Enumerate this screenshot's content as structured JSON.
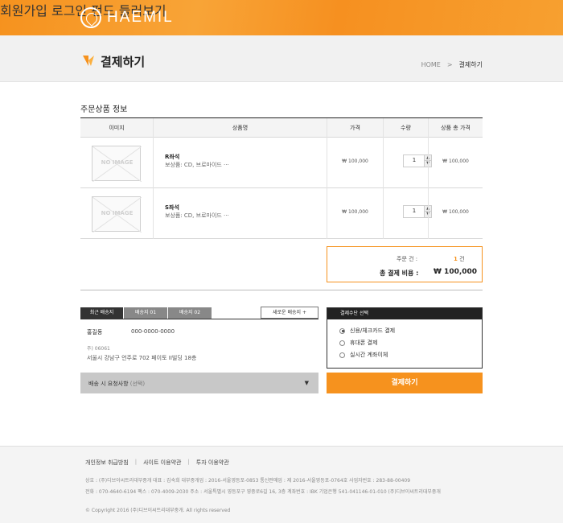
{
  "header": {
    "logo_text": "HAEMIL",
    "nav": [
      "회원가입",
      "로그인",
      "펀드 둘러보기"
    ]
  },
  "title_band": {
    "title": "결제하기",
    "breadcrumb": [
      "HOME",
      ">",
      "결제하기"
    ]
  },
  "order": {
    "section_title": "주문상품 정보",
    "columns": [
      "이미지",
      "상품명",
      "가격",
      "수량",
      "상품 총 가격"
    ],
    "rows": [
      {
        "image": "NO IMAGE",
        "name": "R좌석",
        "desc": "보상품: CD, 브로마이드 ···",
        "price": "₩ 100,000",
        "qty": "1",
        "total": "₩ 100,000"
      },
      {
        "image": "NO IMAGE",
        "name": "S좌석",
        "desc": "보상품: CD, 브로마이드 ···",
        "price": "₩ 100,000",
        "qty": "1",
        "total": "₩ 100,000"
      }
    ],
    "summary": {
      "count_label": "주문 건 :",
      "count_value": "1",
      "count_unit": "건",
      "total_label": "총 결제 비용 :",
      "total_value": "₩ 100,000"
    }
  },
  "delivery": {
    "tabs": [
      "최근 배송지",
      "배송지 01",
      "배송지 02"
    ],
    "new_button": "새로운 배송지 +",
    "name": "홍길동",
    "phone": "000-0000-0000",
    "zip": "주) 06061",
    "address": "서울시 강남구 언주로 702 페이토 II빌딩 18층",
    "request_label": "배송 시 요청사항",
    "request_sub": "(선택)",
    "request_arrow": "▼"
  },
  "payment": {
    "title": "결제수단 선택",
    "options": [
      "신용/체크카드 결제",
      "휴대폰 결제",
      "실시간 계좌이체"
    ],
    "selected": 0,
    "button": "결제하기"
  },
  "footer": {
    "links": [
      "개인정보 취급방침",
      "|",
      "사이트 이용약관",
      "|",
      "투자 이용약관"
    ],
    "info1": "상호 : (주)디브이씨트리대부중개     대표 : 김숙희     대부중개업 : 2016-서울영등포-0853     통신판매업 : 제 2016-서울영등포-0764호     사업자번호 : 283-88-00409",
    "info2": "전화 : 070-4640-6194   팩스 : 070-4009-2030   주소 : 서울특별시 영등포구 영중로6길 16, 3층   계좌번호 : IBK 기업은행 541-041146-01-010 (주)디브이씨트리대부중개",
    "copyright": "© Copyright 2016 (주)디브이씨트리대부중개. All rights reserved"
  },
  "colors": {
    "accent": "#f6921e",
    "dark": "#222222"
  }
}
